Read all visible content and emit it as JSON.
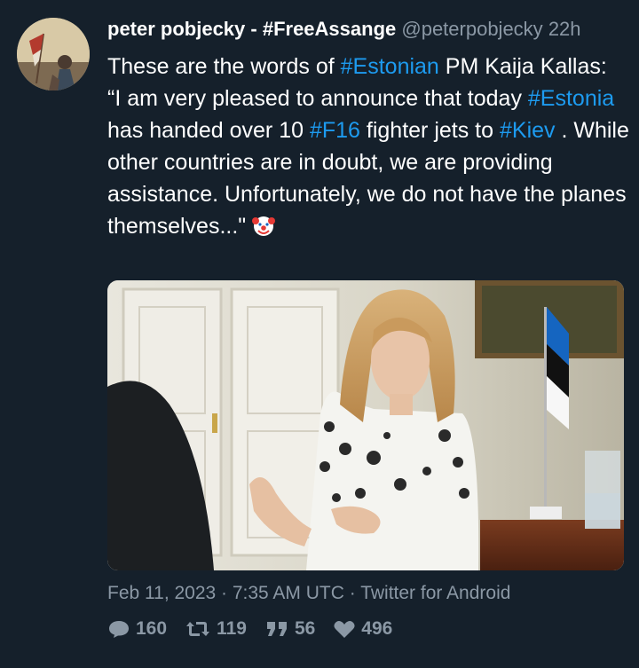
{
  "tweet": {
    "author_name": "peter pobjecky - #FreeAssange",
    "handle": "@peterpobjecky",
    "age": "22h",
    "text": {
      "p1": "These are the words of ",
      "tag_estonian": "#Estonian",
      "p2": " PM Kaija Kallas:",
      "p3": "“I am very pleased to announce that today ",
      "tag_estonia": "#Estonia",
      "p4": " has handed over 10 ",
      "tag_f16": "#F16",
      "p5": " fighter jets to ",
      "tag_kiev": "#Kiev",
      "p6": " . While other countries are in doubt, we are providing assistance. Unfortunately, we do not have the planes themselves...\""
    },
    "emoji": "clown-face-icon",
    "timestamp": "Feb 11, 2023 · 7:35 AM UTC · Twitter for Android",
    "stats": {
      "replies": "160",
      "retweets": "119",
      "quotes": "56",
      "likes": "496"
    }
  },
  "colors": {
    "background": "#15202b",
    "text": "#ffffff",
    "muted": "#8b98a5",
    "link": "#1d9bf0"
  }
}
